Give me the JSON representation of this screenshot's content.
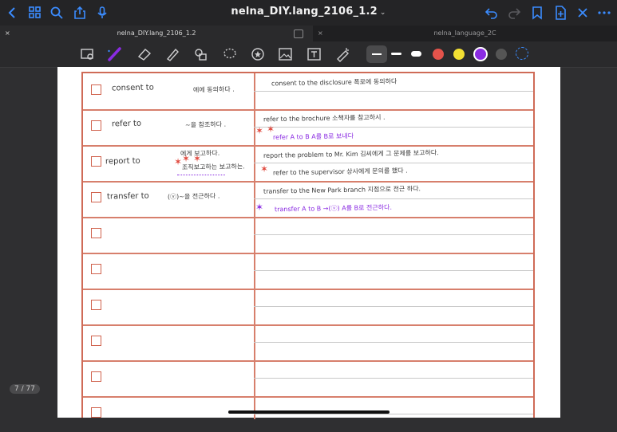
{
  "window": {
    "title": "nelna_DIY.lang_2106_1.2",
    "title_chevron": "⌄"
  },
  "tabs": [
    {
      "label": "nelna_DIY.lang_2106_1.2",
      "close": "×",
      "active": true
    },
    {
      "label": "nelna_language_2C",
      "close": "×",
      "active": false
    }
  ],
  "toolbar": {
    "colors": {
      "white_line": "#ffffff",
      "white_dot": "#ffffff",
      "red": "#e5534b",
      "yellow": "#f3e033",
      "purple": "#8a2be2",
      "dark": "#555555"
    }
  },
  "notebook": {
    "rows": [
      {
        "term": "consent to",
        "meaning": "에에 동의하다 .",
        "examples": [
          "consent to the disclosure 폭로에 동의하다"
        ]
      },
      {
        "term": "refer to",
        "meaning": "~을 참조하다 .",
        "examples": [
          "refer to the brochure 소책자를 참고하시 .",
          "refer A to B          A를 B로 보내다"
        ]
      },
      {
        "term": "report to",
        "meaning": "에게 보고하다.",
        "meaning2": "조직보고하는 보고하는.",
        "examples": [
          "report the problem to Mr. Kim 김씨에게 그 문제를 보고하다.",
          "refer to the supervisor 상사에게 문의를 했다 ."
        ]
      },
      {
        "term": "transfer to",
        "meaning": "(ⓥ)~을 전근하다 .",
        "examples": [
          "transfer to the New Park branch 지점으로 전근 하다.",
          "transfer A to B   →(ⓥ) A를 B로 전근하다."
        ]
      },
      {
        "term": "",
        "meaning": "",
        "examples": [
          "",
          ""
        ]
      },
      {
        "term": "",
        "meaning": "",
        "examples": [
          "",
          ""
        ]
      },
      {
        "term": "",
        "meaning": "",
        "examples": [
          "",
          ""
        ]
      },
      {
        "term": "",
        "meaning": "",
        "examples": [
          "",
          ""
        ]
      },
      {
        "term": "",
        "meaning": "",
        "examples": [
          "",
          ""
        ]
      },
      {
        "term": "",
        "meaning": "",
        "examples": [
          "",
          ""
        ]
      }
    ]
  },
  "page_indicator": "7 / 77"
}
